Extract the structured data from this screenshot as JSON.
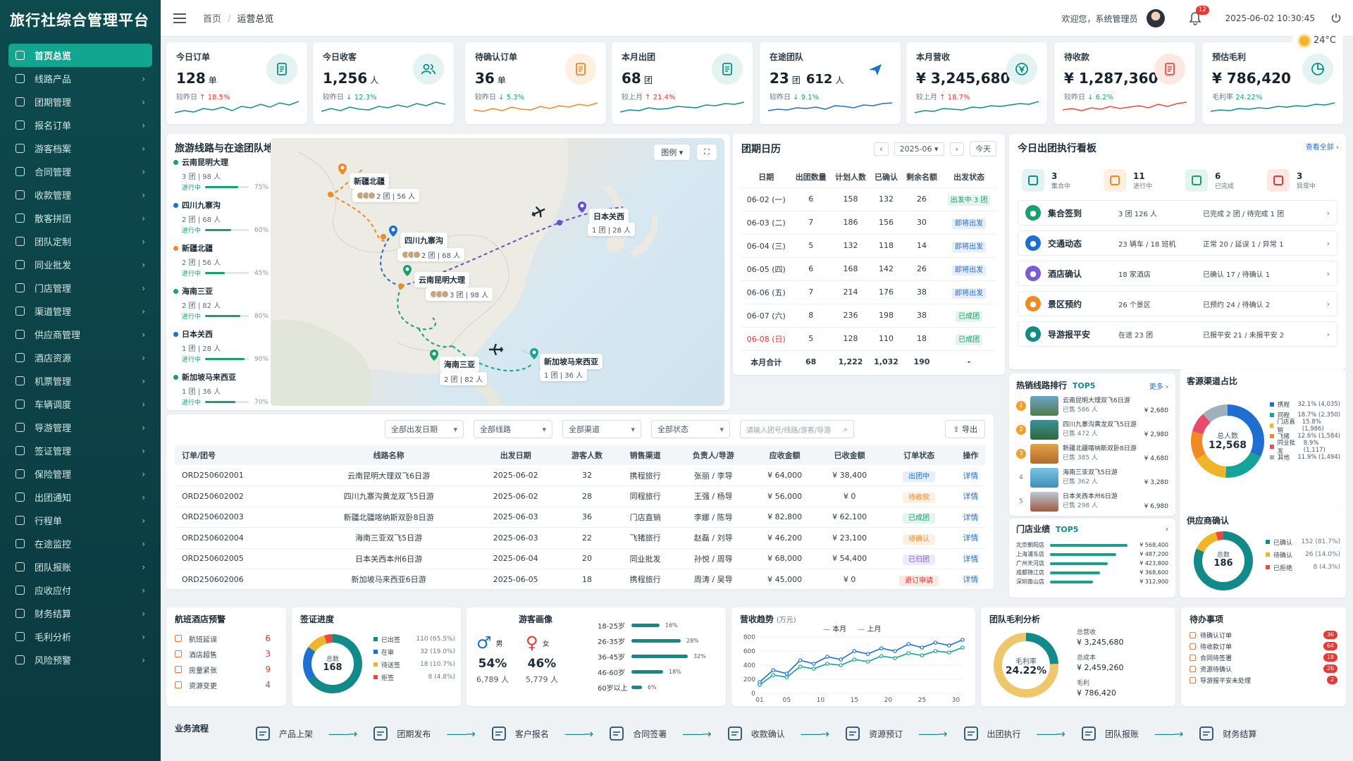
{
  "app_title": "旅行社综合管理平台",
  "breadcrumb": {
    "home": "首页",
    "current": "运营总览"
  },
  "topbar": {
    "welcome": "欢迎您，系统管理员",
    "notif_count": "12",
    "datetime": "2025-06-02  10:30:45",
    "weather": "24°C"
  },
  "sidebar": {
    "items": [
      {
        "label": "首页总览",
        "icon": "home-icon"
      },
      {
        "label": "线路产品",
        "icon": "compass-icon"
      },
      {
        "label": "团期管理",
        "icon": "calendar-icon"
      },
      {
        "label": "报名订单",
        "icon": "file-icon"
      },
      {
        "label": "游客档案",
        "icon": "user-icon"
      },
      {
        "label": "合同管理",
        "icon": "contract-icon"
      },
      {
        "label": "收款管理",
        "icon": "receipt-icon"
      },
      {
        "label": "散客拼团",
        "icon": "group-icon"
      },
      {
        "label": "团队定制",
        "icon": "team-icon"
      },
      {
        "label": "同业批发",
        "icon": "store-icon"
      },
      {
        "label": "门店管理",
        "icon": "shop-icon"
      },
      {
        "label": "渠道管理",
        "icon": "channel-icon"
      },
      {
        "label": "供应商管理",
        "icon": "building-icon"
      },
      {
        "label": "酒店资源",
        "icon": "hotel-icon"
      },
      {
        "label": "机票管理",
        "icon": "plane-icon"
      },
      {
        "label": "车辆调度",
        "icon": "car-icon"
      },
      {
        "label": "导游管理",
        "icon": "guide-icon"
      },
      {
        "label": "签证管理",
        "icon": "visa-icon"
      },
      {
        "label": "保险管理",
        "icon": "shield-icon"
      },
      {
        "label": "出团通知",
        "icon": "notice-icon"
      },
      {
        "label": "行程单",
        "icon": "itinerary-icon"
      },
      {
        "label": "在途监控",
        "icon": "location-icon"
      },
      {
        "label": "团队报账",
        "icon": "ledger-icon"
      },
      {
        "label": "应收应付",
        "icon": "money-icon"
      },
      {
        "label": "财务结算",
        "icon": "wallet-icon"
      },
      {
        "label": "毛利分析",
        "icon": "chart-icon"
      },
      {
        "label": "风险预警",
        "icon": "alert-icon"
      }
    ]
  },
  "kpis": [
    {
      "title": "今日订单",
      "value": "128",
      "unit": "单",
      "cmp_label": "较昨日",
      "dir": "up",
      "delta": "18.5%",
      "color": "#0e8f86",
      "icon": "document-icon",
      "icon_bg": "#e3f3f1"
    },
    {
      "title": "今日收客",
      "value": "1,256",
      "unit": "人",
      "cmp_label": "较昨日",
      "dir": "dn",
      "delta": "12.3%",
      "color": "#0e8f86",
      "icon": "users-icon",
      "icon_bg": "#e3f3f1"
    },
    {
      "title": "待确认订单",
      "value": "36",
      "unit": "单",
      "cmp_label": "较昨日",
      "dir": "dn",
      "delta": "5.3%",
      "color": "#f08a24",
      "icon": "pending-doc-icon",
      "icon_bg": "#fdf0e1"
    },
    {
      "title": "本月出团",
      "value": "68",
      "unit": "团",
      "cmp_label": "较上月",
      "dir": "up",
      "delta": "21.4%",
      "color": "#0e8f86",
      "icon": "suitcase-icon",
      "icon_bg": "#e3f3f1"
    },
    {
      "title": "在途团队",
      "value": "23",
      "unit": "团",
      "value2": "612",
      "unit2": "人",
      "cmp_label": "较昨日",
      "dir": "dn",
      "delta": "9.1%",
      "color": "#1f6fd1",
      "icon": "airplane-icon",
      "icon_bg": "#ffffff"
    },
    {
      "title": "本月营收",
      "value": "¥ 3,245,680",
      "unit": "",
      "cmp_label": "较上月",
      "dir": "up",
      "delta": "18.7%",
      "color": "#0e8f86",
      "icon": "yen-icon",
      "icon_bg": "#e3f3f1"
    },
    {
      "title": "待收款",
      "value": "¥ 1,287,360",
      "unit": "",
      "cmp_label": "较昨日",
      "dir": "dn",
      "delta": "6.2%",
      "color": "#e84b3c",
      "icon": "wallet-icon",
      "icon_bg": "#fde8e4"
    },
    {
      "title": "预估毛利",
      "value": "¥ 786,420",
      "unit": "",
      "cmp_label": "毛利率",
      "dir": "none",
      "delta": "24.22%",
      "color": "#0e8f86",
      "icon": "pie-icon",
      "icon_bg": "#e3f3f1"
    }
  ],
  "map": {
    "title": "旅游线路与在途团队地图",
    "legend_btn": "图例",
    "routes": [
      {
        "name": "云南昆明大理",
        "sub": "3 团  |  98 人",
        "status": "进行中",
        "pct": 75,
        "pct_label": "75%",
        "color": "#19a06e"
      },
      {
        "name": "四川九寨沟",
        "sub": "2 团  |  68 人",
        "status": "进行中",
        "pct": 60,
        "pct_label": "60%",
        "color": "#1f6fd1"
      },
      {
        "name": "新疆北疆",
        "sub": "2 团  |  56 人",
        "status": "进行中",
        "pct": 45,
        "pct_label": "45%",
        "color": "#f08a24"
      },
      {
        "name": "海南三亚",
        "sub": "2 团  |  82 人",
        "status": "进行中",
        "pct": 80,
        "pct_label": "80%",
        "color": "#19a06e"
      },
      {
        "name": "日本关西",
        "sub": "1 团  |  28 人",
        "status": "进行中",
        "pct": 90,
        "pct_label": "90%",
        "color": "#1f6fd1"
      },
      {
        "name": "新加坡马来西亚",
        "sub": "1 团  |  36 人",
        "status": "进行中",
        "pct": 70,
        "pct_label": "70%",
        "color": "#19a06e"
      }
    ],
    "pins": [
      {
        "name": "新疆北疆",
        "sub": "2 团  |  56 人"
      },
      {
        "name": "四川九寨沟",
        "sub": "2 团  |  68 人"
      },
      {
        "name": "云南昆明大理",
        "sub": "3 团  |  98 人"
      },
      {
        "name": "日本关西",
        "sub": "1 团  |  28 人"
      },
      {
        "name": "海南三亚",
        "sub": "2 团  |  82 人"
      },
      {
        "name": "新加坡马来西亚",
        "sub": "1 团  |  36 人"
      }
    ]
  },
  "calendar": {
    "title": "团期日历",
    "month": "2025-06",
    "today": "今天",
    "headers": [
      "日期",
      "出团数量",
      "计划人数",
      "已确认",
      "剩余名额",
      "出发状态"
    ],
    "rows": [
      [
        "06-02 (一)",
        "6",
        "158",
        "132",
        "26",
        "出发中 3 团",
        "go"
      ],
      [
        "06-03 (二)",
        "7",
        "186",
        "156",
        "30",
        "即将出发",
        "soon"
      ],
      [
        "06-04 (三)",
        "5",
        "132",
        "118",
        "14",
        "即将出发",
        "soon"
      ],
      [
        "06-05 (四)",
        "6",
        "168",
        "142",
        "26",
        "即将出发",
        "soon"
      ],
      [
        "06-06 (五)",
        "7",
        "214",
        "176",
        "38",
        "即将出发",
        "soon"
      ],
      [
        "06-07 (六)",
        "8",
        "236",
        "198",
        "38",
        "已成团",
        "ok"
      ],
      [
        "06-08 (日)",
        "5",
        "128",
        "110",
        "18",
        "已成团",
        "ok"
      ]
    ],
    "total": [
      "本月合计",
      "68",
      "1,222",
      "1,032",
      "190",
      "-"
    ]
  },
  "board": {
    "title": "今日出团执行看板",
    "more": "查看全部",
    "summary": [
      {
        "n": "3",
        "l": "集合中",
        "color": "#0e8f86",
        "bg": "#e3f3f1"
      },
      {
        "n": "11",
        "l": "进行中",
        "color": "#f08a24",
        "bg": "#fdf0e1"
      },
      {
        "n": "6",
        "l": "已完成",
        "color": "#19a06e",
        "bg": "#e3f5ed"
      },
      {
        "n": "3",
        "l": "异常中",
        "color": "#e53935",
        "bg": "#fde8e4"
      }
    ],
    "rows": [
      {
        "name": "集合签到",
        "count": "3 团   126 人",
        "status": "已完成 2 团 / 待完成 1 团",
        "color": "#19a06e"
      },
      {
        "name": "交通动态",
        "count": "23 辆车 / 18 班机",
        "status": "正常 20 / 延误 1 / 异常 1",
        "color": "#1f6fd1"
      },
      {
        "name": "酒店确认",
        "count": "18 家酒店",
        "status": "已确认 17 / 待确认 1",
        "color": "#7b5cd6"
      },
      {
        "name": "景区预约",
        "count": "26 个景区",
        "status": "已预约 24 / 待确认 2",
        "color": "#f08a24"
      },
      {
        "name": "导游报平安",
        "count": "在途 23 团",
        "status": "已报平安 21 / 未报平安 2",
        "color": "#0e8f86"
      }
    ]
  },
  "orders": {
    "filters": [
      "全部出发日期",
      "全部线路",
      "全部渠道",
      "全部状态"
    ],
    "search_placeholder": "请输入团号/线路/游客/导游",
    "export": "导出",
    "headers": [
      "订单/团号",
      "线路名称",
      "出发日期",
      "游客人数",
      "销售渠道",
      "负责人/导游",
      "应收金额",
      "已收金额",
      "订单状态",
      "操作"
    ],
    "rows": [
      [
        "ORD250602001",
        "云南昆明大理双飞6日游",
        "2025-06-02",
        "32",
        "携程旅行",
        "张丽 / 李导",
        "¥ 64,000",
        "¥ 38,400",
        "出团中",
        "详情",
        "blue"
      ],
      [
        "ORD250602002",
        "四川九寨沟黄龙双飞5日游",
        "2025-06-02",
        "28",
        "同程旅行",
        "王强 / 杨导",
        "¥ 56,000",
        "¥ 0",
        "待收款",
        "详情",
        "orange"
      ],
      [
        "ORD250602003",
        "新疆北疆喀纳斯双卧8日游",
        "2025-06-03",
        "36",
        "门店直销",
        "李娜 / 陈导",
        "¥ 82,800",
        "¥ 62,100",
        "已成团",
        "详情",
        "green"
      ],
      [
        "ORD250602004",
        "海南三亚双飞5日游",
        "2025-06-03",
        "22",
        "飞猪旅行",
        "赵磊 / 刘导",
        "¥ 46,200",
        "¥ 23,100",
        "待确认",
        "详情",
        "orange"
      ],
      [
        "ORD250602005",
        "日本关西本州6日游",
        "2025-06-04",
        "20",
        "同业批发",
        "孙悦 / 周导",
        "¥ 68,000",
        "¥ 54,400",
        "已归团",
        "详情",
        "purple"
      ],
      [
        "ORD250602006",
        "新加坡马来西亚6日游",
        "2025-06-05",
        "18",
        "携程旅行",
        "周涛 / 吴导",
        "¥ 45,000",
        "¥ 0",
        "退订申请",
        "详情",
        "red"
      ]
    ]
  },
  "hot": {
    "title": "热销线路排行",
    "tag": "TOP5",
    "more": "更多",
    "items": [
      {
        "rank": "1",
        "name": "云南昆明大理双飞6日游",
        "sold": "已售 586 人",
        "price": "¥ 2,680",
        "c1": "#6fa3c8",
        "c2": "#4f7d4a"
      },
      {
        "rank": "2",
        "name": "四川九寨沟黄龙双飞5日游",
        "sold": "已售 472 人",
        "price": "¥ 2,980",
        "c1": "#3d8f9a",
        "c2": "#2d6a3a"
      },
      {
        "rank": "3",
        "name": "新疆北疆喀纳斯双卧8日游",
        "sold": "已售 385 人",
        "price": "¥ 4,680",
        "c1": "#e0a44a",
        "c2": "#b56a2c"
      },
      {
        "rank": "4",
        "name": "海南三亚双飞5日游",
        "sold": "已售 362 人",
        "price": "¥ 3,280",
        "c1": "#7bc4e6",
        "c2": "#3e8fb5"
      },
      {
        "rank": "5",
        "name": "日本关西本州6日游",
        "sold": "已售 298 人",
        "price": "¥ 6,980",
        "c1": "#b8c9da",
        "c2": "#a35b3e"
      }
    ]
  },
  "channels": {
    "title": "客源渠道占比",
    "center_label": "总人数",
    "center_value": "12,568",
    "items": [
      {
        "name": "携程",
        "pct": "32.1% (4,035)",
        "v": 32.1,
        "color": "#1f6fd1"
      },
      {
        "name": "同程",
        "pct": "18.7% (2,350)",
        "v": 18.7,
        "color": "#16a39a"
      },
      {
        "name": "门店直销",
        "pct": "15.8% (1,986)",
        "v": 15.8,
        "color": "#f0b429"
      },
      {
        "name": "飞猪",
        "pct": "12.6% (1,584)",
        "v": 12.6,
        "color": "#f08a24"
      },
      {
        "name": "同业批发",
        "pct": "8.9% (1,117)",
        "v": 8.9,
        "color": "#e84b6c"
      },
      {
        "name": "其他",
        "pct": "11.9% (1,494)",
        "v": 11.9,
        "color": "#9fb0bd"
      }
    ]
  },
  "store": {
    "title": "门店业绩",
    "tag": "TOP5",
    "items": [
      {
        "name": "北京朝阳店",
        "val": "¥ 568,400",
        "v": 568400
      },
      {
        "name": "上海浦东店",
        "val": "¥ 487,200",
        "v": 487200
      },
      {
        "name": "广州天河店",
        "val": "¥ 423,800",
        "v": 423800
      },
      {
        "name": "成都锦江店",
        "val": "¥ 368,600",
        "v": 368600
      },
      {
        "name": "深圳南山店",
        "val": "¥ 312,900",
        "v": 312900
      }
    ]
  },
  "supplier": {
    "title": "供应商确认",
    "center_label": "总数",
    "center_value": "186",
    "items": [
      {
        "name": "已确认",
        "val": "152 (81.7%)",
        "v": 152,
        "color": "#138a8a"
      },
      {
        "name": "待确认",
        "val": "26 (14.0%)",
        "v": 26,
        "color": "#f0b429"
      },
      {
        "name": "已拒绝",
        "val": "8 (4.3%)",
        "v": 8,
        "color": "#e84b3c"
      }
    ]
  },
  "warn": {
    "title": "航班酒店预警",
    "items": [
      {
        "name": "航班延误",
        "n": "6"
      },
      {
        "name": "酒店超售",
        "n": "3"
      },
      {
        "name": "房量紧张",
        "n": "9"
      },
      {
        "name": "资源变更",
        "n": "4"
      }
    ]
  },
  "visa": {
    "title": "签证进度",
    "center_label": "总数",
    "center_value": "168",
    "items": [
      {
        "name": "已出签",
        "val": "110 (65.5%)",
        "v": 110,
        "color": "#138a8a"
      },
      {
        "name": "在审",
        "val": "32 (19.0%)",
        "v": 32,
        "color": "#1f6fd1"
      },
      {
        "name": "待送签",
        "val": "18 (10.7%)",
        "v": 18,
        "color": "#f0b429"
      },
      {
        "name": "拒签",
        "val": "8 (4.8%)",
        "v": 8,
        "color": "#e84b3c"
      }
    ]
  },
  "profile": {
    "title": "游客画像",
    "male": {
      "label": "男",
      "pct": "54%",
      "count": "6,789 人"
    },
    "female": {
      "label": "女",
      "pct": "46%",
      "count": "5,779 人"
    },
    "ages": [
      {
        "a": "18-25岁",
        "p": "16%",
        "v": 16
      },
      {
        "a": "26-35岁",
        "p": "28%",
        "v": 28
      },
      {
        "a": "36-45岁",
        "p": "32%",
        "v": 32
      },
      {
        "a": "46-60岁",
        "p": "18%",
        "v": 18
      },
      {
        "a": "60岁以上",
        "p": "6%",
        "v": 6
      }
    ]
  },
  "revenue": {
    "title": "营收趋势",
    "unit": "(万元)",
    "legend_cur": "本月",
    "legend_prev": "上月",
    "chart_data": {
      "type": "line",
      "x": [
        1,
        3,
        5,
        7,
        9,
        11,
        13,
        15,
        17,
        19,
        21,
        23,
        25,
        27,
        29,
        31
      ],
      "xticks": [
        "01",
        "05",
        "10",
        "15",
        "20",
        "25",
        "30"
      ],
      "yticks": [
        "800",
        "600",
        "400",
        "200",
        "0"
      ],
      "ylim": [
        0,
        800
      ],
      "series": [
        {
          "name": "本月",
          "values": [
            160,
            330,
            280,
            470,
            420,
            520,
            480,
            600,
            560,
            640,
            600,
            700,
            650,
            720,
            680,
            760
          ],
          "color": "#1f6fd1"
        },
        {
          "name": "上月",
          "values": [
            120,
            260,
            230,
            380,
            350,
            420,
            400,
            480,
            450,
            530,
            500,
            570,
            540,
            600,
            580,
            650
          ],
          "color": "#16a39a"
        }
      ]
    }
  },
  "margin": {
    "title": "团队毛利分析",
    "center_label": "毛利率",
    "center_value": "24.22%",
    "pct": 24.22,
    "items": [
      {
        "k": "总营收",
        "v": "¥ 3,245,680"
      },
      {
        "k": "总成本",
        "v": "¥ 2,459,260"
      },
      {
        "k": "毛利",
        "v": "¥ 786,420"
      }
    ]
  },
  "todo": {
    "title": "待办事项",
    "items": [
      {
        "name": "待确认订单",
        "c": "36"
      },
      {
        "name": "待收款订单",
        "c": "64"
      },
      {
        "name": "合同待签署",
        "c": "18"
      },
      {
        "name": "资源待确认",
        "c": "26"
      },
      {
        "name": "导游报平安未处理",
        "c": "2"
      }
    ]
  },
  "flow": {
    "title": "业务流程",
    "steps": [
      {
        "label": "产品上架",
        "icon": "box-icon"
      },
      {
        "label": "团期发布",
        "icon": "calendar-icon"
      },
      {
        "label": "客户报名",
        "icon": "user-add-icon"
      },
      {
        "label": "合同签署",
        "icon": "contract-icon"
      },
      {
        "label": "收款确认",
        "icon": "yen-icon"
      },
      {
        "label": "资源预订",
        "icon": "building-icon"
      },
      {
        "label": "出团执行",
        "icon": "flag-icon"
      },
      {
        "label": "团队报账",
        "icon": "ledger-icon"
      },
      {
        "label": "财务结算",
        "icon": "settle-icon"
      }
    ]
  }
}
